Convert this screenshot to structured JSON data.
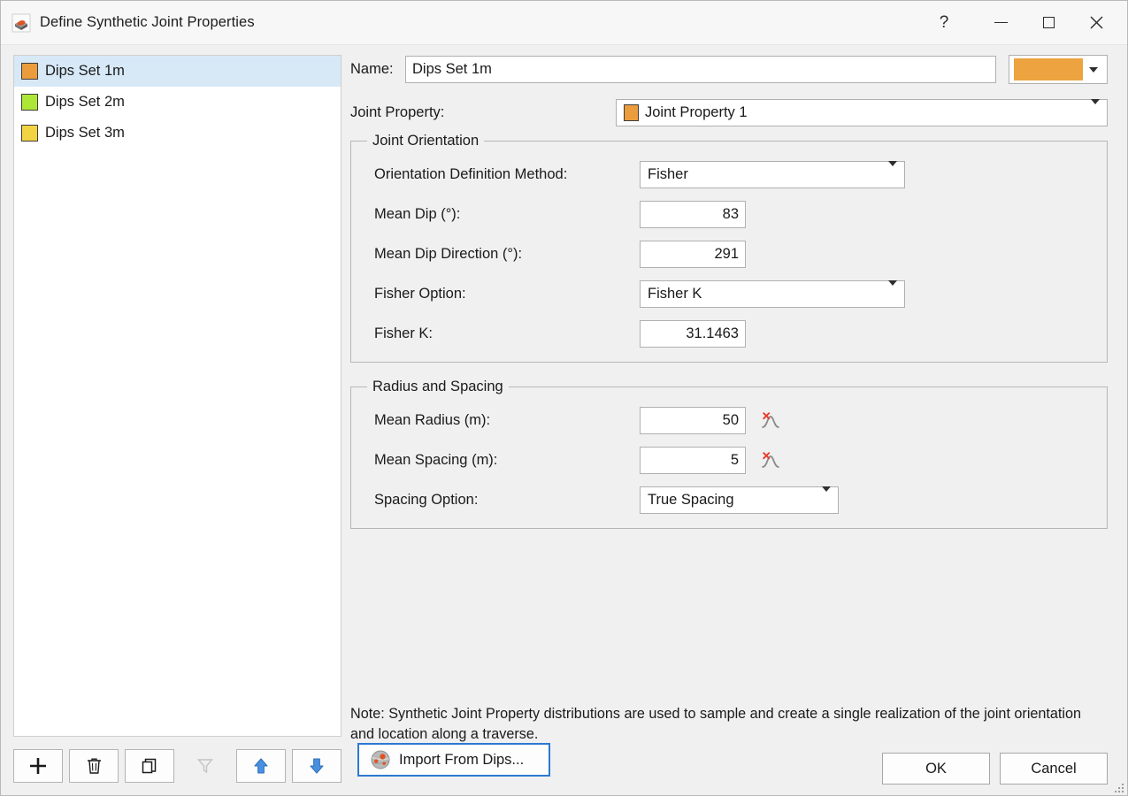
{
  "window": {
    "title": "Define Synthetic Joint Properties",
    "icon": "joint-block-icon",
    "controls": {
      "help": "?",
      "minimize": "minimize-icon",
      "maximize": "maximize-icon",
      "close": "close-icon"
    }
  },
  "sidebar": {
    "items": [
      {
        "label": "Dips Set 1m",
        "color": "#eb9c3c",
        "selected": true
      },
      {
        "label": "Dips Set 2m",
        "color": "#aee638",
        "selected": false
      },
      {
        "label": "Dips Set 3m",
        "color": "#f2d342",
        "selected": false
      }
    ],
    "toolbar": [
      {
        "name": "add-button",
        "icon": "plus-icon",
        "enabled": true
      },
      {
        "name": "delete-button",
        "icon": "trash-icon",
        "enabled": true
      },
      {
        "name": "duplicate-button",
        "icon": "copy-icon",
        "enabled": true
      },
      {
        "name": "filter-button",
        "icon": "funnel-icon",
        "enabled": false
      },
      {
        "name": "move-up-button",
        "icon": "arrow-up-icon",
        "enabled": true
      },
      {
        "name": "move-down-button",
        "icon": "arrow-down-icon",
        "enabled": true
      }
    ]
  },
  "form": {
    "name_label": "Name:",
    "name_value": "Dips Set 1m",
    "color_value": "#eda340",
    "joint_property_label": "Joint Property:",
    "joint_property_value": "Joint Property 1",
    "joint_property_color": "#eb9c3c"
  },
  "joint_orientation": {
    "title": "Joint Orientation",
    "orientation_method_label": "Orientation Definition Method:",
    "orientation_method_value": "Fisher",
    "mean_dip_label": "Mean Dip (°):",
    "mean_dip_value": "83",
    "mean_dip_direction_label": "Mean Dip Direction (°):",
    "mean_dip_direction_value": "291",
    "fisher_option_label": "Fisher Option:",
    "fisher_option_value": "Fisher K",
    "fisher_k_label": "Fisher K:",
    "fisher_k_value": "31.1463"
  },
  "radius_and_spacing": {
    "title": "Radius and Spacing",
    "mean_radius_label": "Mean Radius (m):",
    "mean_radius_value": "50",
    "mean_spacing_label": "Mean Spacing (m):",
    "mean_spacing_value": "5",
    "spacing_option_label": "Spacing Option:",
    "spacing_option_value": "True Spacing",
    "distribution_icon": "no-distribution-icon"
  },
  "note": "Note: Synthetic Joint Property distributions are used to sample and create a single realization of the joint orientation and location along a traverse.",
  "footer": {
    "import_label": "Import From Dips...",
    "import_icon": "dips-sphere-icon",
    "ok_label": "OK",
    "cancel_label": "Cancel"
  }
}
